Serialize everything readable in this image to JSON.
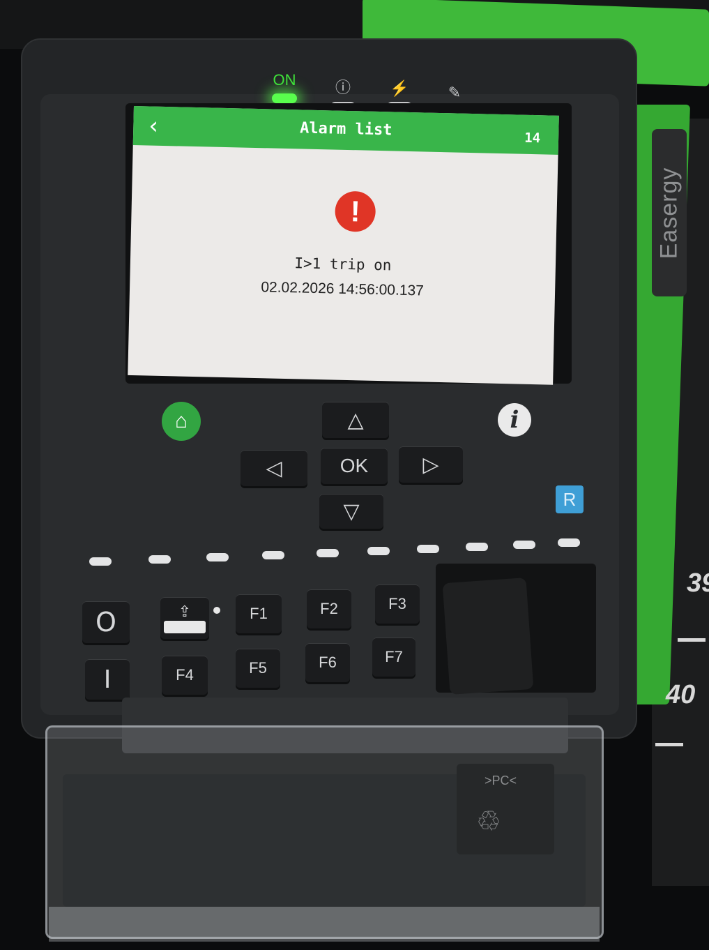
{
  "colors": {
    "brand_green": "#3fb93a",
    "screen_header_green": "#39b54a",
    "alarm_red": "#e03526",
    "reset_blue": "#3f9fd6",
    "device_body": "#232527"
  },
  "leds": [
    {
      "label": "ON",
      "icon": "power-on-led",
      "lit": true
    },
    {
      "label": "!",
      "icon": "warning-icon",
      "lit": false
    },
    {
      "label": "⚡",
      "icon": "trip-icon",
      "lit": false
    },
    {
      "label": "🔧",
      "icon": "wrench-icon",
      "lit": false
    }
  ],
  "screen": {
    "back_icon": "chevron-left-icon",
    "back_glyph": "‹",
    "title": "Alarm list",
    "count": "14",
    "alarm_icon": "alert-circle-icon",
    "alarm_glyph": "!",
    "alarm_text": "I>1 trip on",
    "alarm_timestamp": "02.02.2026  14:56:00.137"
  },
  "keypad": {
    "home_icon": "home-icon",
    "home_glyph": "⌂",
    "info_glyph": "i",
    "reset_label": "R",
    "up_glyph": "△",
    "down_glyph": "▽",
    "left_glyph": "◁",
    "right_glyph": "▷",
    "ok_label": "OK",
    "open_glyph": "O",
    "close_glyph": "I",
    "local_remote_icon": "local-remote-icon",
    "function_keys": [
      "F1",
      "F2",
      "F3",
      "F4",
      "F5",
      "F6",
      "F7"
    ]
  },
  "side_panel": {
    "brand": "Easergy",
    "scale_numbers": [
      "39",
      "40"
    ]
  },
  "cover": {
    "material_mark": ">PC<"
  }
}
